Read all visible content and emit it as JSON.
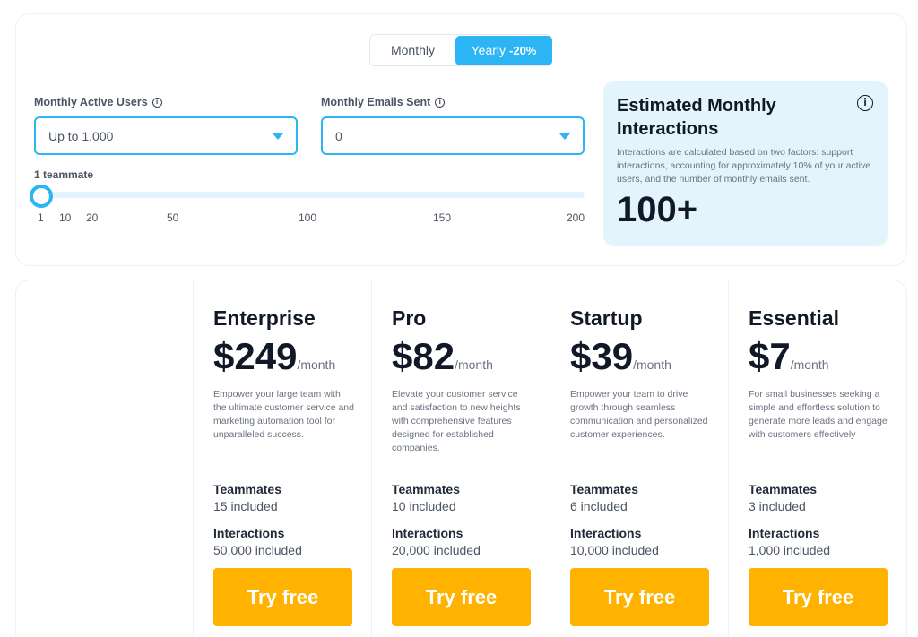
{
  "billing_toggle": {
    "monthly": "Monthly",
    "yearly": "Yearly",
    "yearly_discount": "-20%",
    "selected": "Yearly"
  },
  "users_field": {
    "label": "Monthly Active Users",
    "value": "Up to 1,000"
  },
  "emails_field": {
    "label": "Monthly Emails Sent",
    "value": "0"
  },
  "teammates_slider": {
    "label": "1 teammate",
    "value": 1,
    "ticks": [
      "1",
      "10",
      "20",
      "50",
      "100",
      "150",
      "200"
    ]
  },
  "estimate": {
    "title": "Estimated Monthly Interactions",
    "description": "Interactions are calculated based on two factors: support interactions, accounting for approximately 10% of your active users, and the number of monthly emails sent.",
    "value": "100+"
  },
  "plans": [
    {
      "name": "Enterprise",
      "price": "$249",
      "period": "/month",
      "description": "Empower your large team with the ultimate customer service and marketing automation tool for unparalleled success.",
      "teammates_label": "Teammates",
      "teammates": "15 included",
      "interactions_label": "Interactions",
      "interactions": "50,000 included",
      "cta": "Try free"
    },
    {
      "name": "Pro",
      "price": "$82",
      "period": "/month",
      "description": "Elevate your customer service and satisfaction to new heights with comprehensive features designed for established companies.",
      "teammates_label": "Teammates",
      "teammates": "10 included",
      "interactions_label": "Interactions",
      "interactions": "20,000 included",
      "cta": "Try free"
    },
    {
      "name": "Startup",
      "price": "$39",
      "period": "/month",
      "description": "Empower your team to drive growth through seamless communication and personalized customer experiences.",
      "teammates_label": "Teammates",
      "teammates": "6 included",
      "interactions_label": "Interactions",
      "interactions": "10,000 included",
      "cta": "Try free"
    },
    {
      "name": "Essential",
      "price": "$7",
      "period": "/month",
      "description": "For small businesses seeking a simple and effortless solution to generate more leads and engage with customers effectively",
      "teammates_label": "Teammates",
      "teammates": "3 included",
      "interactions_label": "Interactions",
      "interactions": "1,000 included",
      "cta": "Try free"
    }
  ],
  "colors": {
    "accent": "#2bb5f5",
    "cta": "#ffb300",
    "estimate_bg": "#e4f4fd"
  }
}
